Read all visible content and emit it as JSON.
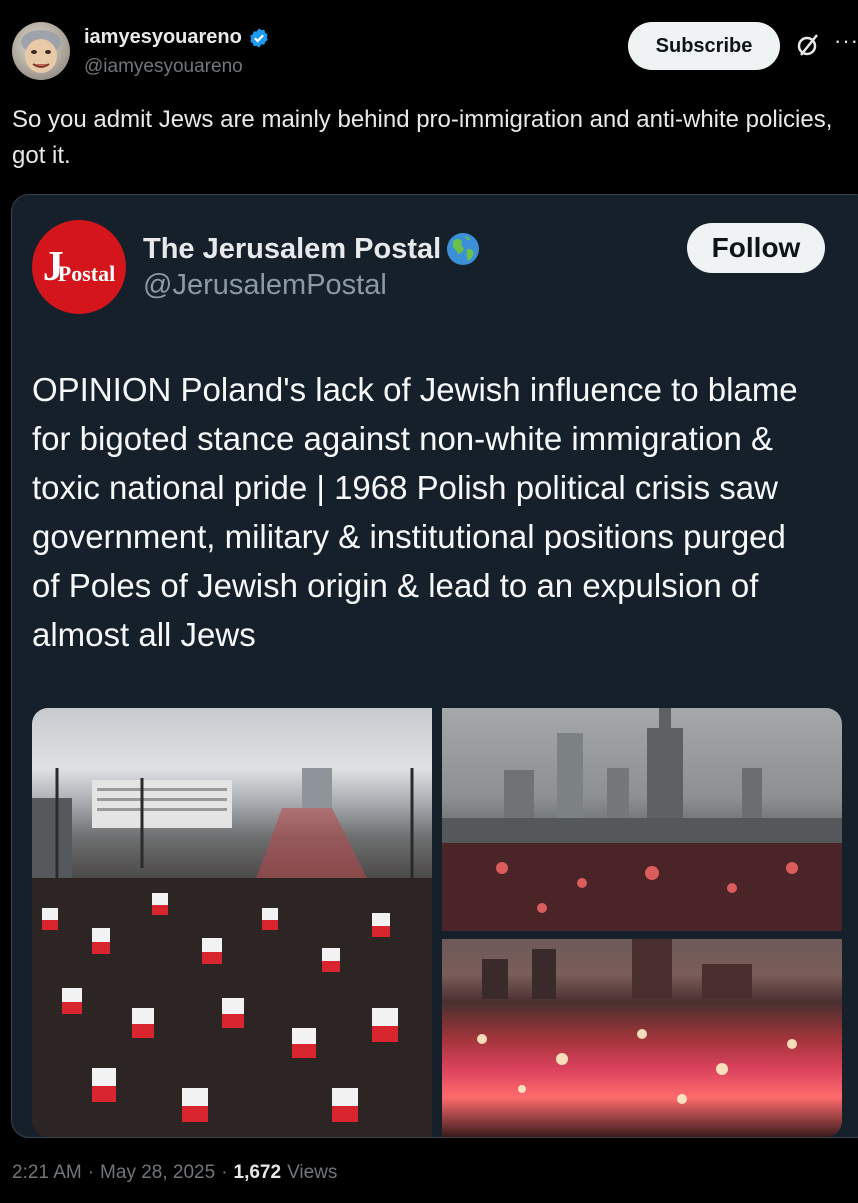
{
  "tweet": {
    "author": {
      "display_name": "iamyesyouareno",
      "handle": "@iamyesyouareno",
      "verified": true,
      "avatar_icon": "cartoon-face-avatar"
    },
    "subscribe_label": "Subscribe",
    "more_icon": "more-dots-icon",
    "grok_icon": "grok-slash-circle-icon",
    "text": "So you admit Jews are mainly behind pro-immigration and anti-white policies, got it.",
    "quoted": {
      "display_name": "The Jerusalem Postal",
      "name_emoji": "🌎",
      "handle": "@JerusalemPostal",
      "logo_text_big": "J",
      "logo_text_small": "Postal",
      "follow_label": "Follow",
      "text": "OPINION Poland's lack of Jewish influence to blame for bigoted stance against non-white immigration & toxic national pride | 1968 Polish political crisis saw government, military & institutional positions purged of Poles of Jewish origin & lead to an expulsion of almost all Jews",
      "images": [
        {
          "name": "crowd-with-flags-photo"
        },
        {
          "name": "city-skyline-flares-photo"
        },
        {
          "name": "red-flares-crowd-photo"
        }
      ]
    },
    "time": "2:21 AM",
    "date": "May 28, 2025",
    "separator": "·",
    "views": "1,672",
    "views_label": "Views"
  },
  "colors": {
    "background": "#000000",
    "card": "#15202b",
    "verified_blue": "#1d9bf0",
    "jp_red": "#d4161c"
  }
}
